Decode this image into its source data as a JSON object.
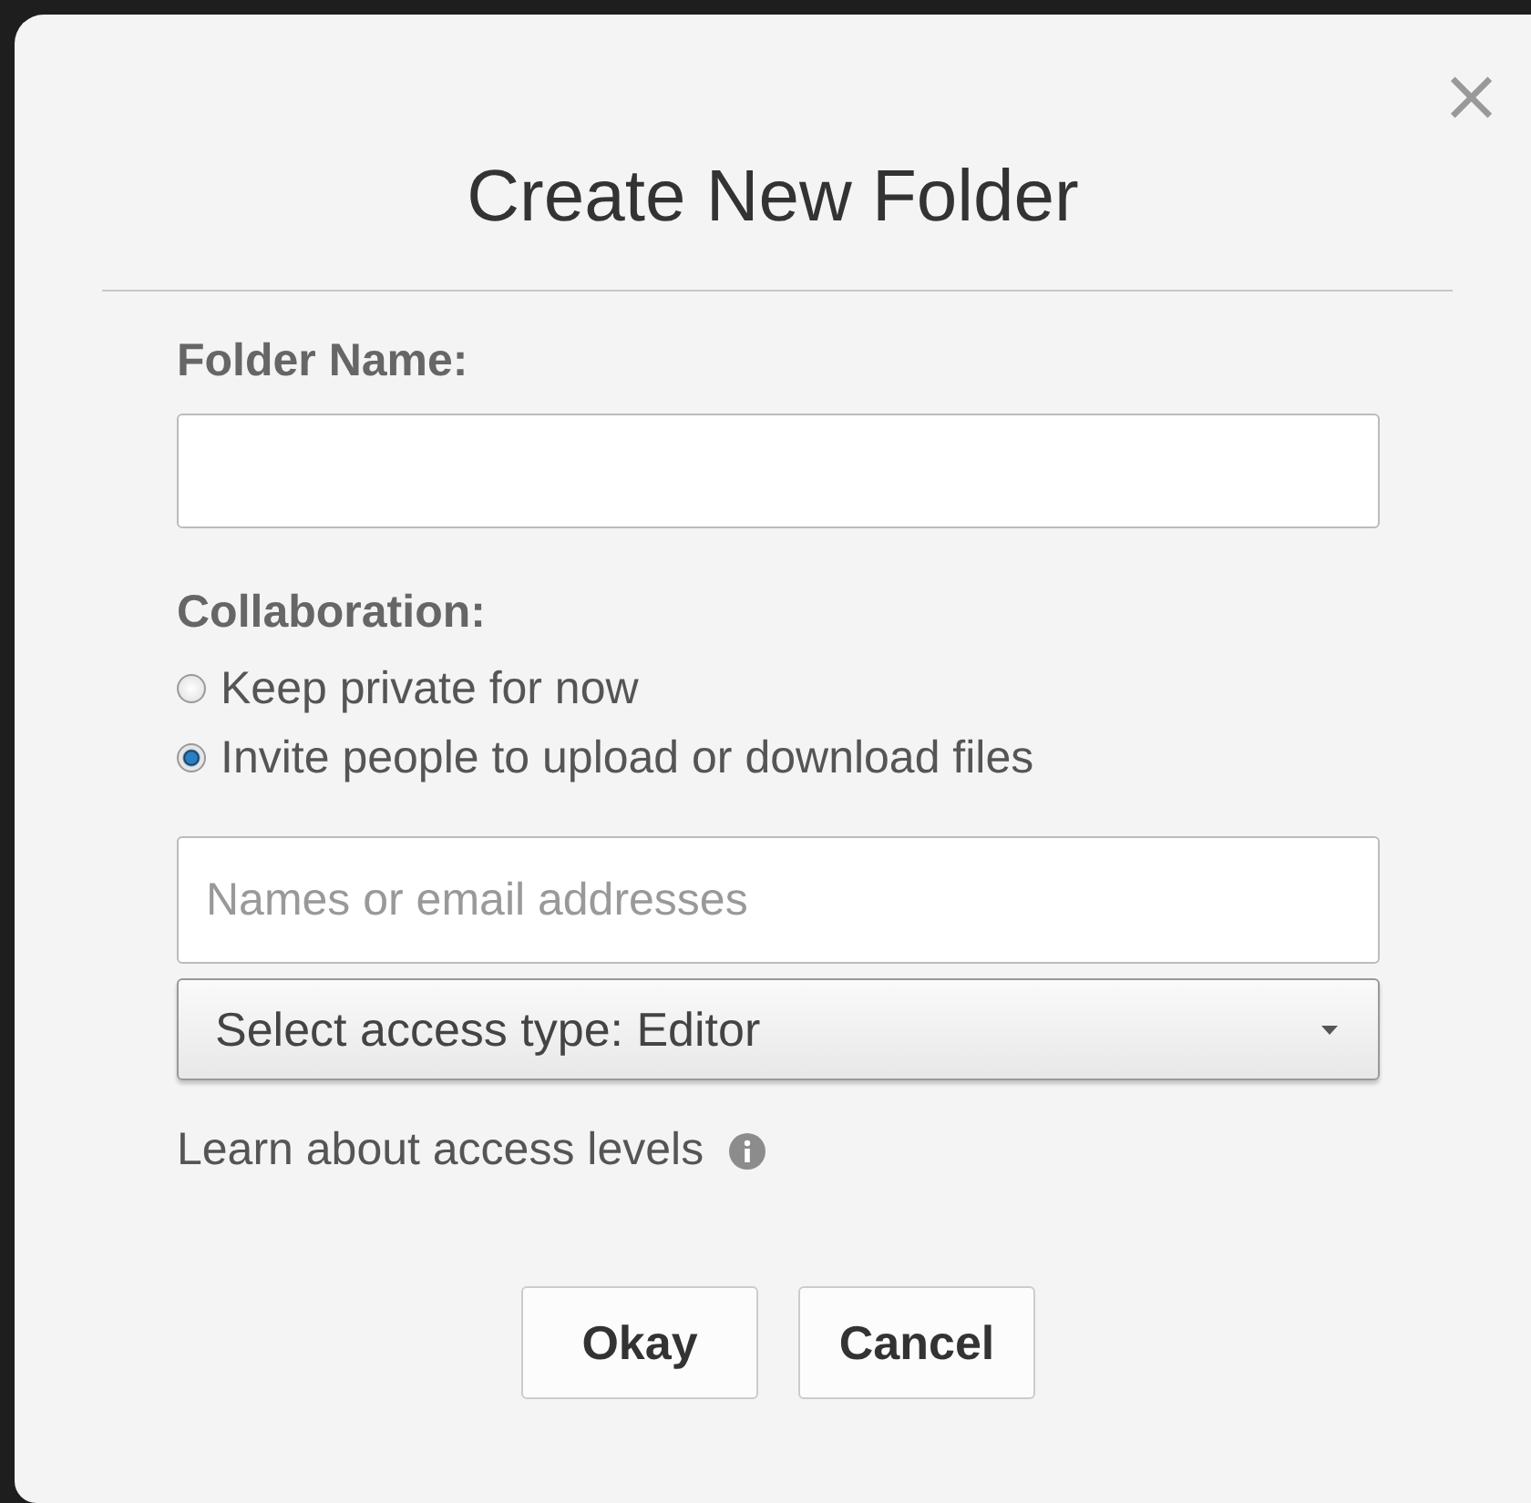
{
  "dialog": {
    "title": "Create New Folder",
    "close": "×"
  },
  "folder_name": {
    "label": "Folder Name:"
  },
  "collaboration": {
    "label": "Collaboration:",
    "options": [
      {
        "label": "Keep private for now",
        "selected": false
      },
      {
        "label": "Invite people to upload or download files",
        "selected": true
      }
    ]
  },
  "invite": {
    "placeholder": "Names or email addresses"
  },
  "access_select": {
    "value": "Select access type: Editor"
  },
  "help_link": "Learn about access levels",
  "buttons": [
    "Okay",
    "Cancel"
  ]
}
